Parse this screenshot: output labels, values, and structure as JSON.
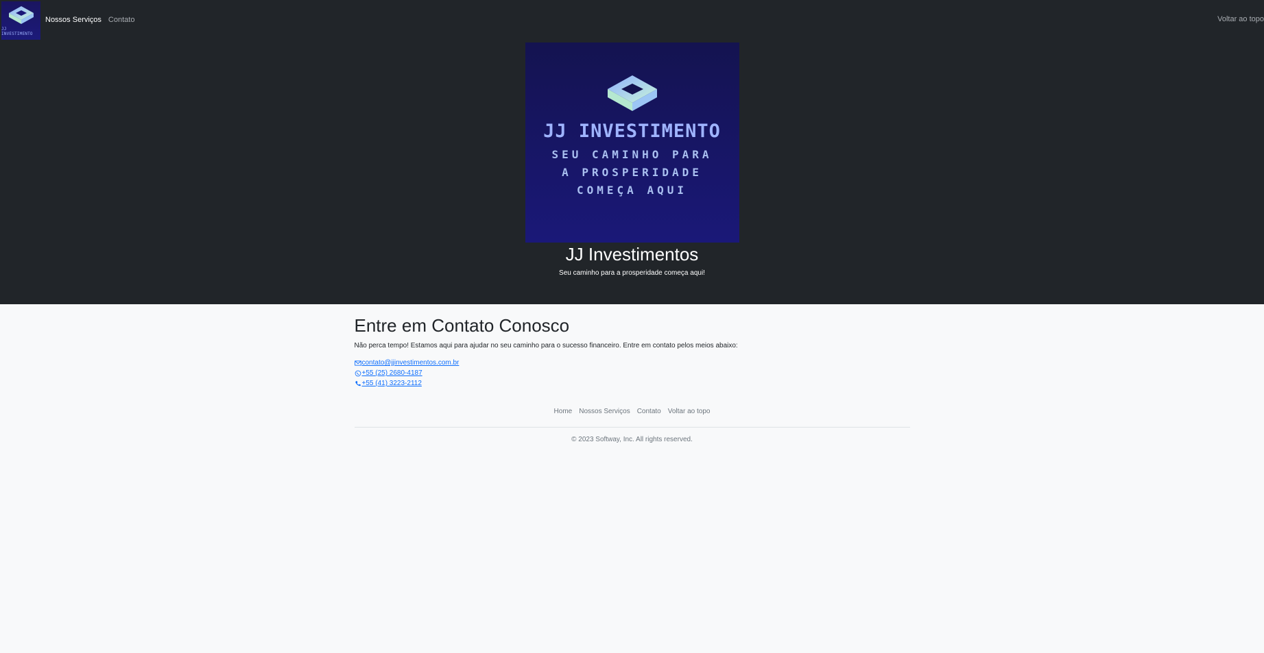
{
  "navbar": {
    "logo_text": "JJ INVESTIMENTO",
    "links": [
      {
        "label": "Nossos Serviços"
      },
      {
        "label": "Contato"
      }
    ],
    "right_link": "Voltar ao topo"
  },
  "hero": {
    "image_logo_text": "JJ INVESTIMENTO",
    "image_tagline_1": "SEU CAMINHO PARA",
    "image_tagline_2": "A PROSPERIDADE",
    "image_tagline_3": "COMEÇA AQUI",
    "title": "JJ Investimentos",
    "subtitle": "Seu caminho para a prosperidade começa aqui!"
  },
  "contact": {
    "title": "Entre em Contato Conosco",
    "text": "Não perca tempo! Estamos aqui para ajudar no seu caminho para o sucesso financeiro. Entre em contato pelos meios abaixo:",
    "email": "contato@jjinvestimentos.com.br",
    "whatsapp": "+55 (25) 2680-4187",
    "phone": "+55 (41) 3223-2112"
  },
  "footer": {
    "links": [
      {
        "label": "Home"
      },
      {
        "label": "Nossos Serviços"
      },
      {
        "label": "Contato"
      },
      {
        "label": "Voltar ao topo"
      }
    ],
    "copyright": "© 2023 Softway, Inc. All rights reserved."
  },
  "colors": {
    "header_bg": "#212529",
    "page_bg": "#f8f9fa",
    "link": "#0d6efd",
    "logo_bg": "#1a1878"
  }
}
